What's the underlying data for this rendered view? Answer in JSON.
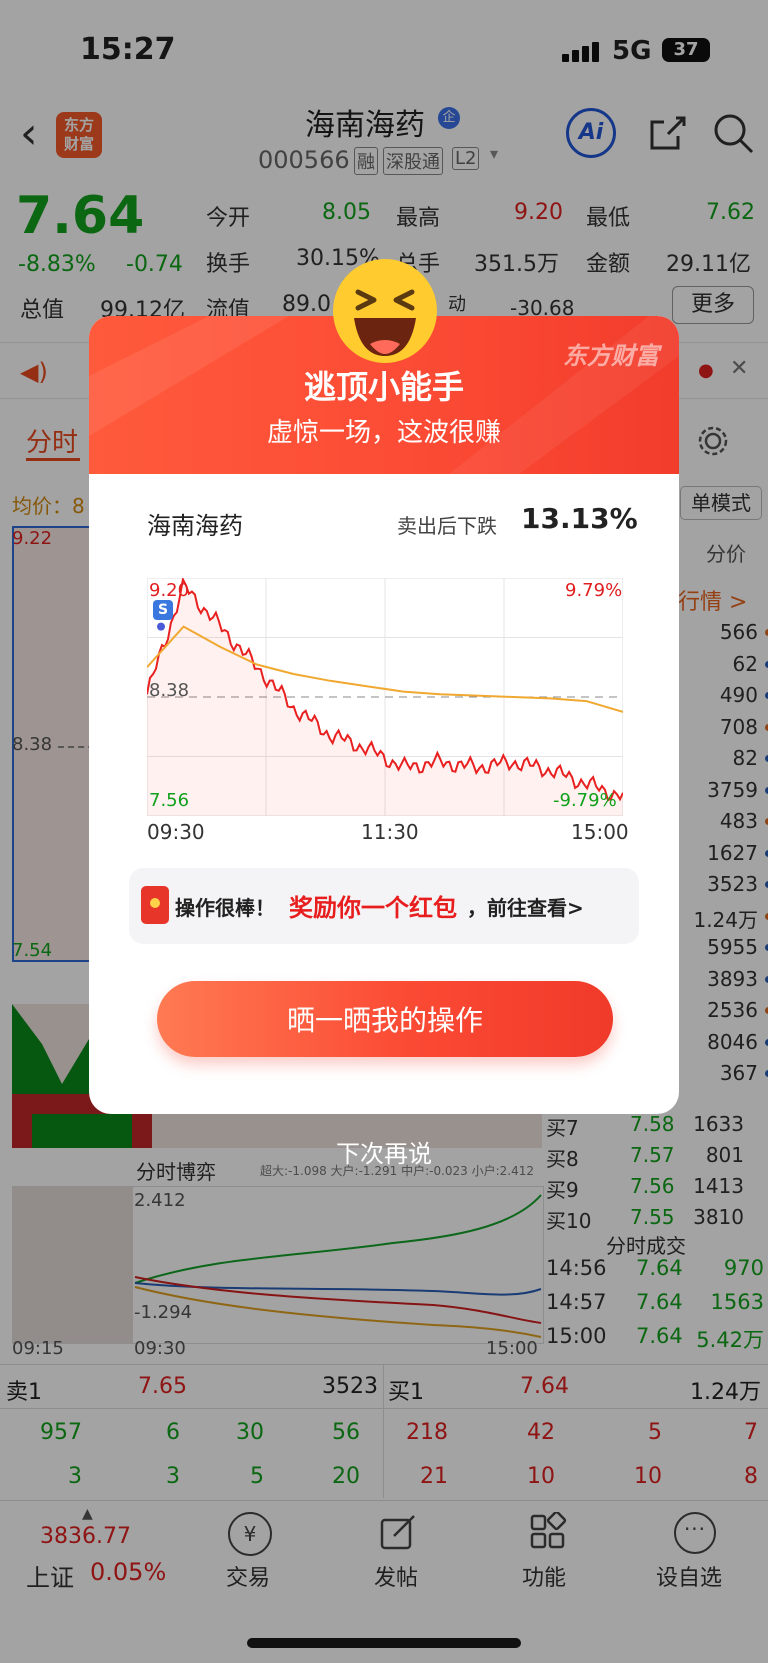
{
  "status": {
    "time": "15:27",
    "signal": "5G",
    "battery": "37"
  },
  "header": {
    "title": "海南海药",
    "badge": "企",
    "code": "000566",
    "tags": [
      "融",
      "深股通",
      "L2"
    ],
    "ai_label": "Ai",
    "logo_line1": "东方",
    "logo_line2": "财富"
  },
  "quote": {
    "price": "7.64",
    "pct": "-8.83%",
    "chg": "-0.74",
    "labels": {
      "open": "今开",
      "high": "最高",
      "low": "最低",
      "turnover": "换手",
      "volume": "总手",
      "amount": "金额",
      "cap": "总值",
      "float": "流值",
      "pe": "动"
    },
    "open": "8.05",
    "high": "9.20",
    "low": "7.62",
    "turnover": "30.15%",
    "volume": "351.5万",
    "amount": "29.11亿",
    "cap": "99.12亿",
    "float": "89.0",
    "pe": "-30.68",
    "more": "更多"
  },
  "bg_chart": {
    "tab": "分时",
    "avg": "均价：8",
    "top_price": "9.22",
    "mid_price": "8.38",
    "low_price": "7.54",
    "mode": "单模式",
    "fenjia": "分价",
    "hangqing": "行情 >",
    "right_vols": [
      "566",
      "62",
      "490",
      "708",
      "82",
      "3759",
      "483",
      "1627",
      "3523",
      "1.24万",
      "5955",
      "3893",
      "2536",
      "8046",
      "367"
    ],
    "buy_rows": [
      {
        "l": "买7",
        "p": "7.58",
        "v": "1633"
      },
      {
        "l": "买8",
        "p": "7.57",
        "v": "801"
      },
      {
        "l": "买9",
        "p": "7.56",
        "v": "1413"
      },
      {
        "l": "买10",
        "p": "7.55",
        "v": "3810"
      }
    ],
    "boyi": {
      "label": "分时博弈",
      "legend": "超大:-1.098 大户:-1.291 中户:-0.023 小户:2.412",
      "top": "2.412",
      "bottom": "-1.294",
      "t1": "09:15",
      "t2": "09:30",
      "t3": "15:00"
    },
    "trades_title": "分时成交",
    "trades": [
      {
        "t": "14:56",
        "p": "7.64",
        "v": "970"
      },
      {
        "t": "14:57",
        "p": "7.64",
        "v": "1563"
      },
      {
        "t": "15:00",
        "p": "7.64",
        "v": "5.42万"
      }
    ],
    "sell1": {
      "l": "卖1",
      "p": "7.65",
      "v": "3523"
    },
    "buy1": {
      "l": "买1",
      "p": "7.64",
      "v": "1.24万"
    },
    "row1": [
      "957",
      "6",
      "30",
      "56",
      "218",
      "42",
      "5",
      "7"
    ],
    "row2": [
      "3",
      "3",
      "5",
      "20",
      "21",
      "10",
      "10",
      "8"
    ]
  },
  "tabbar": {
    "index_value": "3836.77",
    "index_name": "上证",
    "index_pct": "0.05%",
    "items": [
      "交易",
      "发帖",
      "功能",
      "设自选"
    ]
  },
  "modal": {
    "brand": "东方财富",
    "title": "逃顶小能手",
    "subtitle": "虚惊一场，这波很赚",
    "stock": "海南海药",
    "drop_label": "卖出后下跌",
    "drop_value": "13.13%",
    "chart": {
      "top_left": "9.20",
      "top_right": "9.79%",
      "mid": "8.38",
      "bottom_left": "7.56",
      "bottom_right": "-9.79%",
      "x": [
        "09:30",
        "11:30",
        "15:00"
      ],
      "marker": "S"
    },
    "reward": {
      "pre": "操作很棒！",
      "highlight": "奖励你一个红包",
      "post": "，前往查看>"
    },
    "cta": "晒一晒我的操作",
    "skip": "下次再说"
  },
  "chart_data": {
    "type": "line",
    "title": "",
    "x": [
      "09:30",
      "11:30",
      "15:00"
    ],
    "ylim": [
      7.56,
      9.2
    ],
    "baseline": 8.38,
    "series": [
      {
        "name": "",
        "values": [
          8.4,
          9.2,
          8.9,
          8.6,
          8.3,
          8.1,
          8.0,
          7.86,
          7.9,
          7.86,
          7.9,
          7.84,
          7.74,
          7.64
        ]
      },
      {
        "name": "",
        "values": [
          8.6,
          8.9,
          8.75,
          8.62,
          8.55,
          8.5,
          8.46,
          8.42,
          8.4,
          8.39,
          8.38,
          8.37,
          8.35,
          8.27
        ]
      }
    ]
  },
  "colors": {
    "red": "#e02020",
    "green": "#12a11c",
    "accent": "#fb4a34"
  }
}
